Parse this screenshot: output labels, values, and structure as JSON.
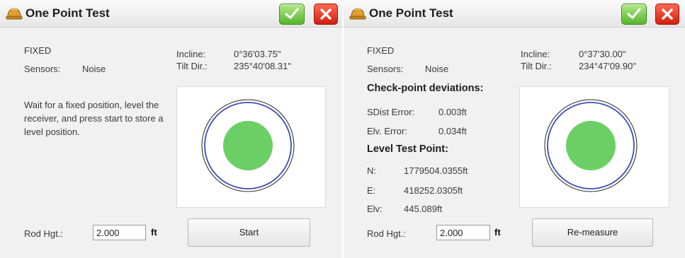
{
  "left": {
    "title": "One Point Test",
    "status": "FIXED",
    "sensors_label": "Sensors:",
    "sensors_value": "Noise",
    "incline_label": "Incline:",
    "incline_value": "0°36'03.75\"",
    "tilt_label": "Tilt Dir.:",
    "tilt_value": "235°40'08.31\"",
    "instructions": "Wait for a fixed position, level the receiver, and press start to store a level position.",
    "rod_label": "Rod Hgt.:",
    "rod_value": "2.000",
    "rod_unit": "ft",
    "action_label": "Start"
  },
  "right": {
    "title": "One Point Test",
    "status": "FIXED",
    "sensors_label": "Sensors:",
    "sensors_value": "Noise",
    "incline_label": "Incline:",
    "incline_value": "0°37'30.00\"",
    "tilt_label": "Tilt Dir.:",
    "tilt_value": "234°47'09.90\"",
    "deviations_heading": "Check-point deviations:",
    "sdist_label": "SDist Error:",
    "sdist_value": "0.003ft",
    "elv_error_label": "Elv. Error:",
    "elv_error_value": "0.034ft",
    "level_point_heading": "Level Test Point:",
    "n_label": "N:",
    "n_value": "1779504.0355ft",
    "e_label": "E:",
    "e_value": "418252.0305ft",
    "elv_label": "Elv:",
    "elv_value": "445.089ft",
    "rod_label": "Rod Hgt.:",
    "rod_value": "2.000",
    "rod_unit": "ft",
    "action_label": "Re-measure"
  },
  "icons": {
    "app": "hard-hat-icon",
    "ok": "checkmark-icon",
    "cancel": "close-icon"
  },
  "colors": {
    "ok_button": "#55b52b",
    "cancel_button": "#d11f0c",
    "bubble": "#6ccf66",
    "target_ring": "#3a4fb8"
  }
}
